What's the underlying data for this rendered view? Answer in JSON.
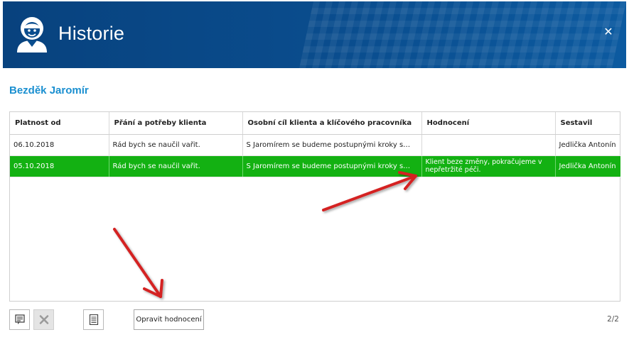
{
  "window": {
    "title": "Historie",
    "close_symbol": "✕",
    "avatar_icon": "user-avatar-icon"
  },
  "client": {
    "name": "Bezděk Jaromír"
  },
  "table": {
    "columns": [
      "Platnost od",
      "Přání a potřeby klienta",
      "Osobní cíl klienta a klíčového pracovníka",
      "Hodnocení",
      "Sestavil"
    ],
    "rows": [
      {
        "date": "06.10.2018",
        "wish": "Rád bych se naučil vařit.",
        "goal": "S Jaromírem se budeme postupnými kroky s…",
        "rating": "",
        "author": "Jedlička Antonín",
        "selected": false
      },
      {
        "date": "05.10.2018",
        "wish": "Rád bych se naučil vařit.",
        "goal": "S Jaromírem se budeme postupnými kroky s…",
        "rating": "Klient beze změny, pokračujeme v nepřetržité péči.",
        "author": "Jedlička Antonín",
        "selected": true
      }
    ]
  },
  "toolbar": {
    "edit_rating_label": "Opravit hodnocení",
    "pager": "2/2"
  },
  "colors": {
    "titlebar": "#0a4d8e",
    "selected_row": "#13b112",
    "client_name": "#1a8fd0",
    "annotation_arrow": "#d42020"
  }
}
